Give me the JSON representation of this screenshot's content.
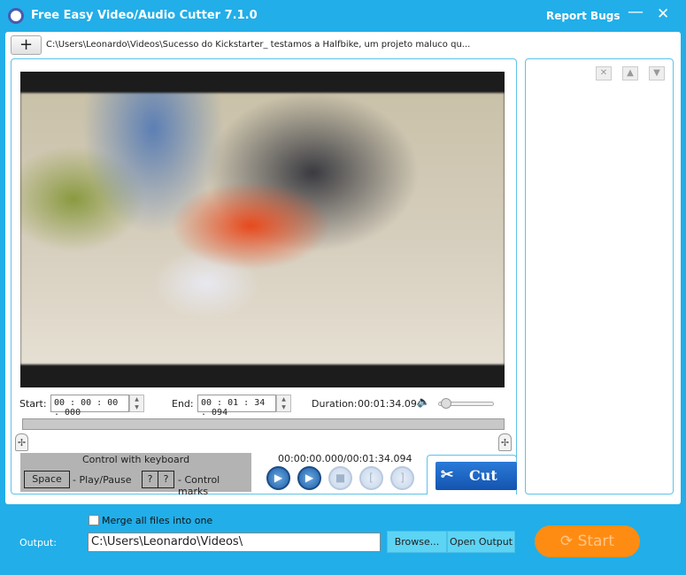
{
  "window": {
    "title": "Free Easy Video/Audio Cutter 7.1.0",
    "report_bugs": "Report Bugs",
    "minimize": "—",
    "close": "✕"
  },
  "toolbar": {
    "add": "+",
    "file_path": "C:\\Users\\Leonardo\\Videos\\Sucesso do Kickstarter_ testamos a Halfbike, um projeto maluco qu..."
  },
  "list_controls": {
    "remove": "✕",
    "up": "▲",
    "down": "▼"
  },
  "times": {
    "start_label": "Start:",
    "start": "00 : 00 : 00 . 000",
    "end_label": "End:",
    "end": "00 : 01 : 34 . 094",
    "duration_label": "Duration:",
    "duration": "00:01:34.094"
  },
  "volume": {
    "level": 0.05
  },
  "keyboard": {
    "title": "Control with keyboard",
    "space_key": "Space",
    "space_desc": "- Play/Pause",
    "mark_key1": "?",
    "mark_key2": "?",
    "marks_desc": "- Control marks"
  },
  "playback": {
    "position": "00:00:00.000/00:01:34.094"
  },
  "cut_label": "Cut",
  "output": {
    "merge_label": "Merge all files into one",
    "merge_checked": false,
    "label": "Output:",
    "path": "C:\\Users\\Leonardo\\Videos\\",
    "browse": "Browse...",
    "open": "Open Output",
    "start": "Start"
  },
  "colors": {
    "accent": "#22aee8",
    "cut": "#1a5cb8",
    "start": "#ff8c12"
  }
}
